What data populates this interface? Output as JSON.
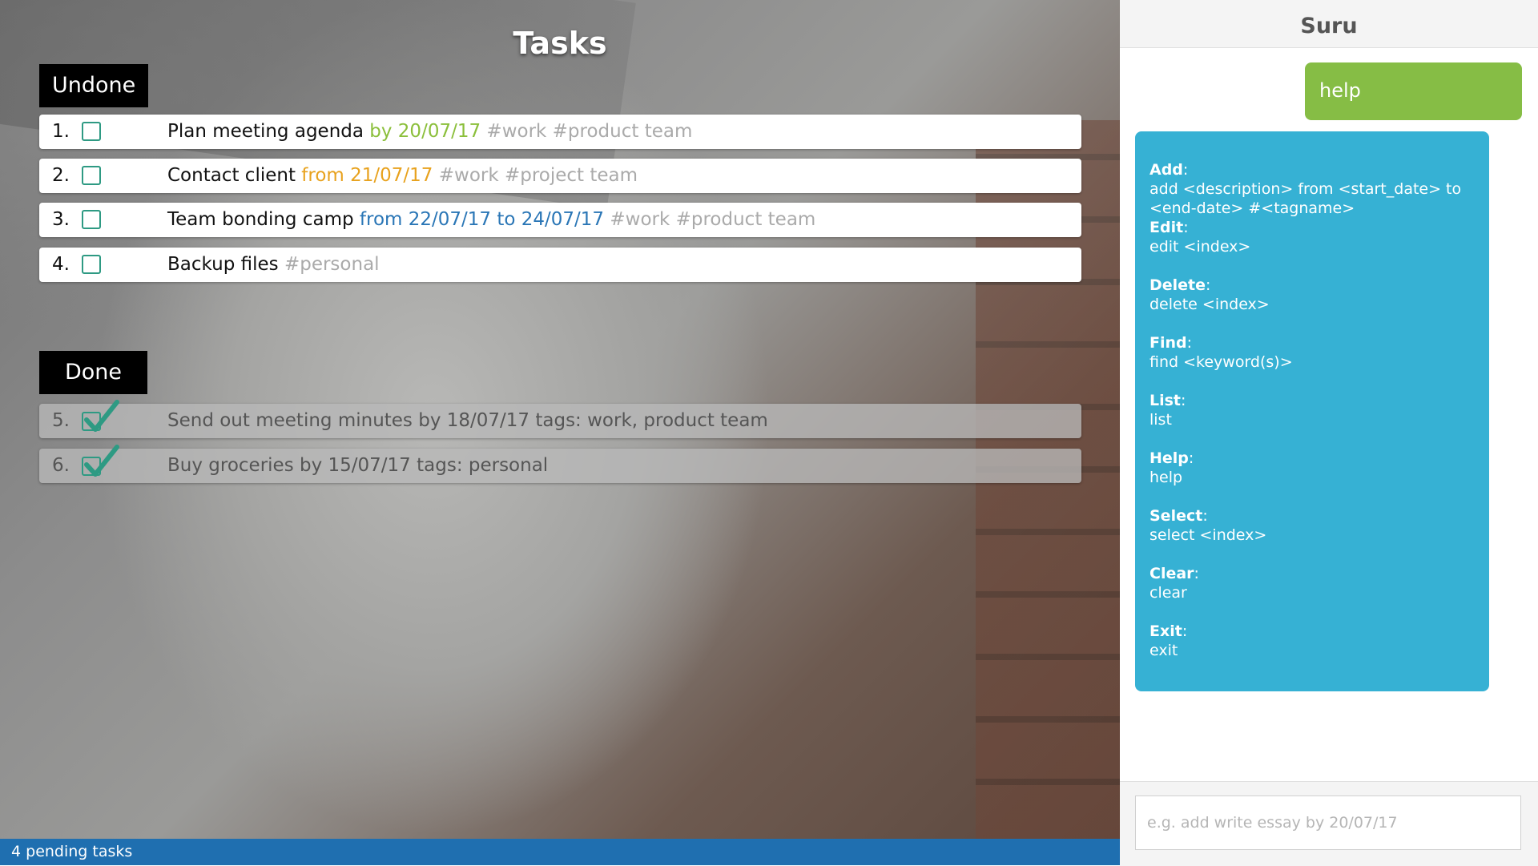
{
  "tasks_panel": {
    "title": "Tasks",
    "undone_label": "Undone",
    "done_label": "Done",
    "undone": [
      {
        "number": "1.",
        "description": "Plan meeting agenda",
        "date": "by 20/07/17",
        "tags": "#work #product team"
      },
      {
        "number": "2.",
        "description": "Contact client",
        "date": "from 21/07/17",
        "tags": "#work #project team"
      },
      {
        "number": "3.",
        "description": "Team bonding camp",
        "date": "from 22/07/17 to 24/07/17",
        "tags": "#work #product team"
      },
      {
        "number": "4.",
        "description": "Backup files",
        "date": "",
        "tags": "#personal"
      }
    ],
    "done": [
      {
        "number": "5.",
        "text": "Send out meeting minutes by 18/07/17 tags: work, product team"
      },
      {
        "number": "6.",
        "text": "Buy groceries by 15/07/17 tags: personal"
      }
    ],
    "status": "4 pending tasks"
  },
  "chat_panel": {
    "title": "Suru",
    "user_message": "help",
    "commands": [
      {
        "name": "Add",
        "usage": "add <description> from <start_date> to <end-date> #<tagname>"
      },
      {
        "name": "Edit",
        "usage": "edit <index>"
      },
      {
        "name": "Delete",
        "usage": "delete <index>"
      },
      {
        "name": "Find",
        "usage": "find <keyword(s)>"
      },
      {
        "name": "List",
        "usage": "list"
      },
      {
        "name": "Help",
        "usage": "help"
      },
      {
        "name": "Select",
        "usage": "select <index>"
      },
      {
        "name": "Clear",
        "usage": "clear"
      },
      {
        "name": "Exit",
        "usage": "exit"
      }
    ],
    "input_value": "",
    "input_placeholder": "e.g. add write essay by 20/07/17"
  },
  "colors": {
    "status_bar": "#1f6fb0",
    "user_bubble": "#86bd45",
    "bot_bubble": "#36b1d4",
    "checkbox": "#2e9a83"
  }
}
